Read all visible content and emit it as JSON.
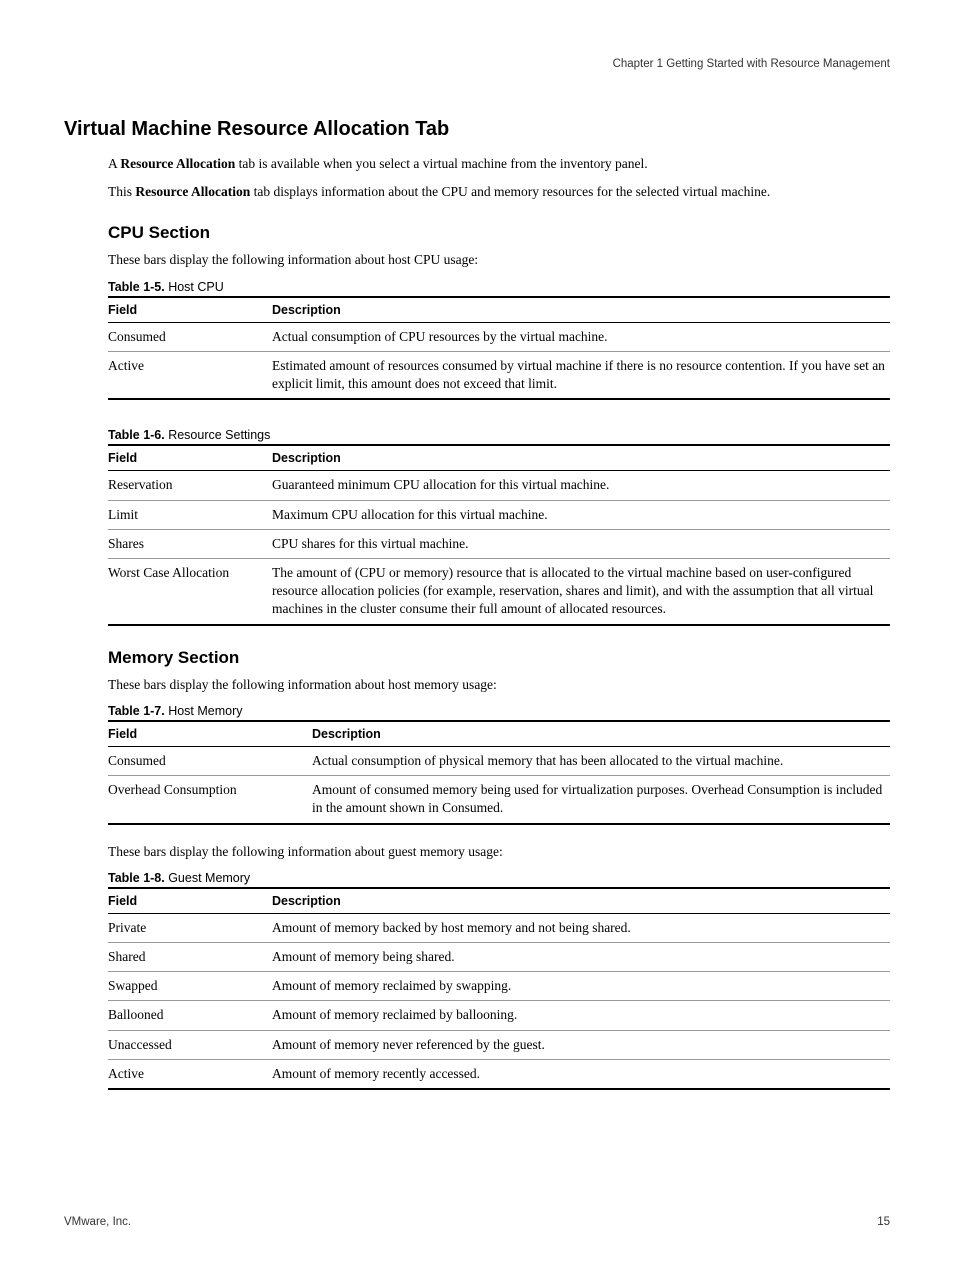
{
  "header": {
    "chapter": "Chapter 1 Getting Started with Resource Management"
  },
  "section": {
    "title": "Virtual Machine Resource Allocation Tab",
    "intro1_a": "A ",
    "intro1_bold": "Resource Allocation",
    "intro1_b": " tab is available when you select a virtual machine from the inventory panel.",
    "intro2_a": "This ",
    "intro2_bold": "Resource Allocation",
    "intro2_b": " tab displays information about the CPU and memory resources for the selected virtual machine."
  },
  "cpu": {
    "heading": "CPU Section",
    "lead": "These bars display the following information about host CPU usage:",
    "table1": {
      "caption_num": "Table 1-5.",
      "caption_text": "  Host CPU",
      "col1": "Field",
      "col2": "Description",
      "rows": [
        {
          "f": "Consumed",
          "d": "Actual consumption of CPU resources by the virtual machine."
        },
        {
          "f": "Active",
          "d": "Estimated amount of resources consumed by virtual machine if there is no resource contention. If you have set an explicit limit, this amount does not exceed that limit."
        }
      ]
    },
    "table2": {
      "caption_num": "Table 1-6.",
      "caption_text": "  Resource Settings",
      "col1": "Field",
      "col2": "Description",
      "rows": [
        {
          "f": "Reservation",
          "d": "Guaranteed minimum CPU allocation for this virtual machine."
        },
        {
          "f": "Limit",
          "d": "Maximum CPU allocation for this virtual machine."
        },
        {
          "f": "Shares",
          "d": "CPU shares for this virtual machine."
        },
        {
          "f": "Worst Case Allocation",
          "d": "The amount of (CPU or memory) resource that is allocated to the virtual machine based on user-configured resource allocation policies (for example, reservation, shares and limit), and with the assumption that all virtual machines in the cluster consume their full amount of allocated resources."
        }
      ]
    }
  },
  "memory": {
    "heading": "Memory Section",
    "lead1": "These bars display the following information about host memory usage:",
    "table1": {
      "caption_num": "Table 1-7.",
      "caption_text": "  Host Memory",
      "col1": "Field",
      "col2": "Description",
      "rows": [
        {
          "f": "Consumed",
          "d": "Actual consumption of physical memory that has been allocated to the virtual machine."
        },
        {
          "f": "Overhead Consumption",
          "d": "Amount of consumed memory being used for virtualization purposes. Overhead Consumption is included in the amount shown in Consumed."
        }
      ]
    },
    "lead2": "These bars display the following information about guest memory usage:",
    "table2": {
      "caption_num": "Table 1-8.",
      "caption_text": "  Guest Memory",
      "col1": "Field",
      "col2": "Description",
      "rows": [
        {
          "f": "Private",
          "d": "Amount of memory backed by host memory and not being shared."
        },
        {
          "f": "Shared",
          "d": "Amount of memory being shared."
        },
        {
          "f": "Swapped",
          "d": "Amount of memory reclaimed by swapping."
        },
        {
          "f": "Ballooned",
          "d": "Amount of memory reclaimed by ballooning."
        },
        {
          "f": "Unaccessed",
          "d": "Amount of memory never referenced by the guest."
        },
        {
          "f": "Active",
          "d": "Amount of memory recently accessed."
        }
      ]
    }
  },
  "footer": {
    "left": "VMware, Inc.",
    "right": "15"
  }
}
